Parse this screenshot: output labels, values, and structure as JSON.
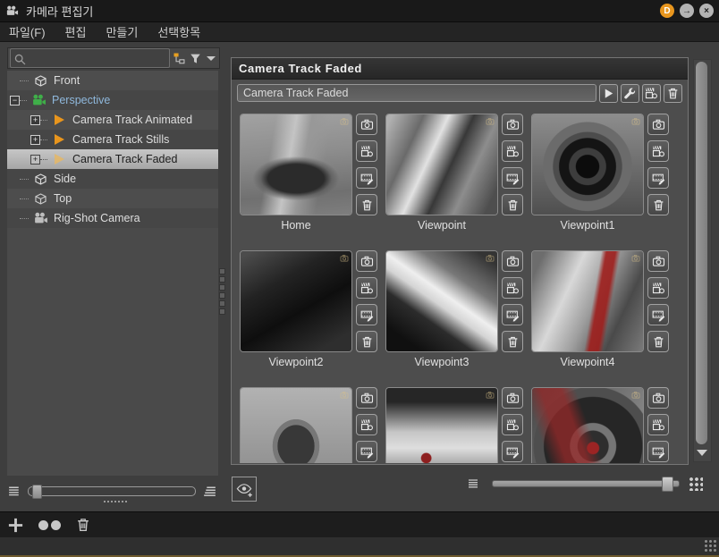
{
  "window": {
    "title": "카메라 편집기",
    "controls": {
      "dock": "D",
      "undock_glyph": "→",
      "close_glyph": "×"
    }
  },
  "menu": {
    "items": [
      {
        "label": "파일(F)"
      },
      {
        "label": "편집"
      },
      {
        "label": "만들기"
      },
      {
        "label": "선택항목"
      }
    ]
  },
  "search": {
    "value": "",
    "placeholder": ""
  },
  "tree": {
    "items": [
      {
        "label": "Front",
        "icon": "cube-icon"
      },
      {
        "label": "Perspective",
        "icon": "perspective-camera-icon",
        "expanded": true
      },
      {
        "label": "Camera Track Animated",
        "icon": "camera-track-icon"
      },
      {
        "label": "Camera Track Stills",
        "icon": "camera-track-icon"
      },
      {
        "label": "Camera Track Faded",
        "icon": "camera-track-faded-icon",
        "selected": true
      },
      {
        "label": "Side",
        "icon": "cube-icon"
      },
      {
        "label": "Top",
        "icon": "cube-icon"
      },
      {
        "label": "Rig-Shot Camera",
        "icon": "movie-camera-icon"
      }
    ],
    "selected": "Camera Track Faded",
    "expanders": {
      "collapsed": "+",
      "expanded": "−"
    }
  },
  "detail": {
    "header": "Camera Track Faded",
    "name_value": "Camera Track Faded",
    "thumbnails": [
      {
        "label": "Home"
      },
      {
        "label": "Viewpoint"
      },
      {
        "label": "Viewpoint1"
      },
      {
        "label": "Viewpoint2"
      },
      {
        "label": "Viewpoint3"
      },
      {
        "label": "Viewpoint4"
      },
      {
        "label": ""
      },
      {
        "label": ""
      },
      {
        "label": ""
      }
    ]
  },
  "icons": {
    "titlebar": "movie-camera-icon",
    "search": "search-icon",
    "search_filters": [
      "hierarchy-filter-icon",
      "funnel-filter-icon",
      "dropdown-arrow-icon"
    ],
    "name_row_buttons": [
      "play-icon",
      "wrench-icon",
      "create-track-icon",
      "trash-icon"
    ],
    "thumbnail_buttons": [
      "camera-icon",
      "film-camera-icon",
      "filmstrip-edit-icon",
      "trash-icon"
    ],
    "bottom_left": [
      "small-rows-icon",
      "size-slider",
      "large-rows-icon",
      "eye-add-icon"
    ],
    "bottom_right": [
      "list-icon",
      "thumbnail-size-slider",
      "grid-icon"
    ],
    "toolbar": [
      "add-icon",
      "clone-icon",
      "trash-icon"
    ],
    "scrollbar": "scroll-down-icon"
  },
  "colors": {
    "accent_orange": "#e8951d",
    "selection_gray": "#b3b3b3",
    "perspective_text_blue": "#8fb8dc",
    "camera_green": "#3fae49",
    "dock_button_orange": "#e8961e",
    "red_accent": "#9c2424"
  }
}
